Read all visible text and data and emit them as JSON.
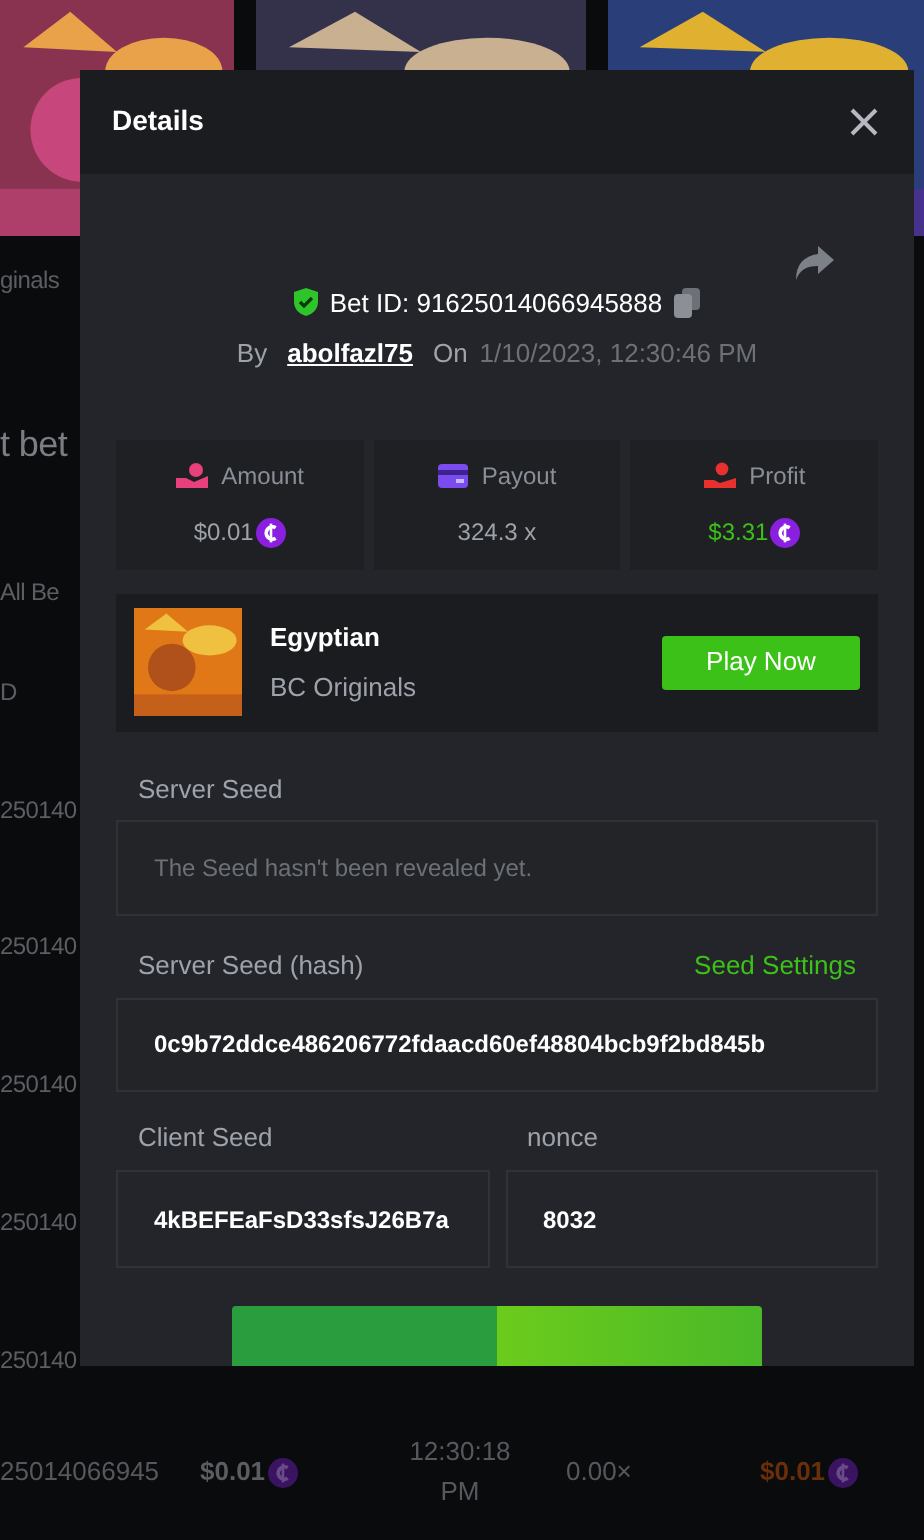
{
  "background": {
    "side_texts": [
      "ginals",
      "t bet",
      "All Be",
      "D",
      "250140",
      "250140",
      "250140",
      "250140",
      "250140"
    ],
    "bottom_row": {
      "id": "25014066945",
      "amount": "$0.01",
      "time": "12:30:18 PM",
      "multiplier": "0.00×",
      "profit": "$0.01"
    }
  },
  "modal": {
    "title": "Details",
    "bet_id": "Bet ID: 91625014066945888",
    "by_label": "By",
    "user": "abolfazl75",
    "on_label": "On",
    "date": "1/10/2023, 12:30:46 PM",
    "stats": [
      {
        "kind": "amount",
        "label": "Amount",
        "value": "$0.01",
        "coin": true
      },
      {
        "kind": "payout",
        "label": "Payout",
        "value": "324.3 x",
        "coin": false
      },
      {
        "kind": "profit",
        "label": "Profit",
        "value": "$3.31",
        "coin": true
      }
    ],
    "game": {
      "name": "Egyptian",
      "provider": "BC Originals",
      "button": "Play Now"
    },
    "server_seed": {
      "label": "Server Seed",
      "message": "The Seed hasn't been revealed yet."
    },
    "server_seed_hash": {
      "label": "Server Seed (hash)",
      "link": "Seed Settings",
      "value": "0c9b72ddce486206772fdaacd60ef48804bcb9f2bd845b"
    },
    "client_seed": {
      "label": "Client Seed",
      "value": "4kBEFEaFsD33sfsJ26B7a"
    },
    "nonce": {
      "label": "nonce",
      "value": "8032"
    }
  }
}
